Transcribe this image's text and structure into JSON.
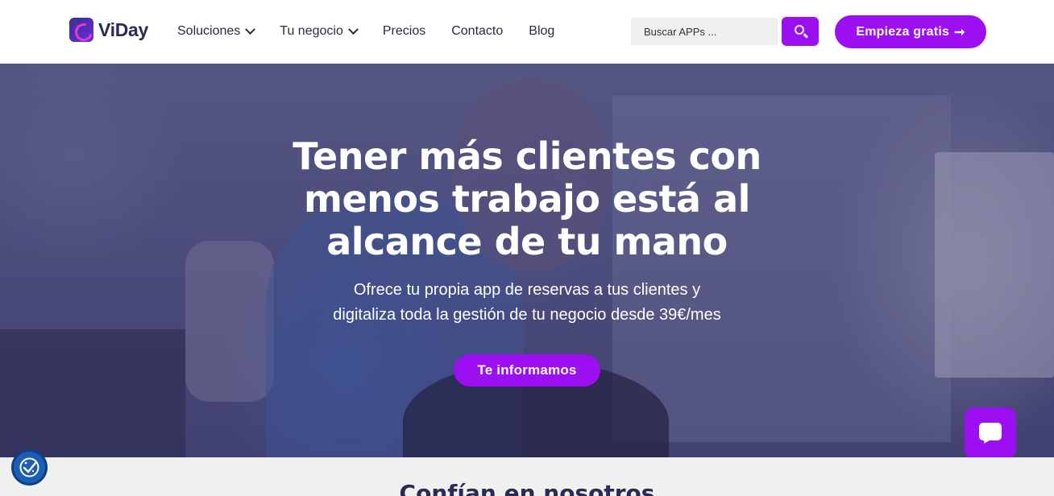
{
  "header": {
    "logo_text": "ViDay",
    "nav": [
      {
        "label": "Soluciones",
        "dropdown": true
      },
      {
        "label": "Tu negocio",
        "dropdown": true
      },
      {
        "label": "Precios",
        "dropdown": false
      },
      {
        "label": "Contacto",
        "dropdown": false
      },
      {
        "label": "Blog",
        "dropdown": false
      }
    ],
    "search": {
      "placeholder": "Buscar APPs ...",
      "value": "",
      "icon": "search-icon"
    },
    "cta_label": "Empieza gratis",
    "cta_arrow": "➞"
  },
  "hero": {
    "title": "Tener más clientes con menos trabajo está al alcance de tu mano",
    "subtitle_line1": "Ofrece tu propia app de reservas a tus clientes y",
    "subtitle_line2": "digitaliza toda la gestión de tu negocio desde 39€/mes",
    "cta_label": "Te informamos"
  },
  "section": {
    "heading": "Confían en nosotros"
  },
  "widgets": {
    "chat_icon": "chat-icon",
    "consent_icon": "cookie-consent-icon"
  },
  "colors": {
    "accent": "#9b0ff0",
    "brand_dark": "#2a2a55",
    "consent_blue": "#1a5fb4"
  }
}
